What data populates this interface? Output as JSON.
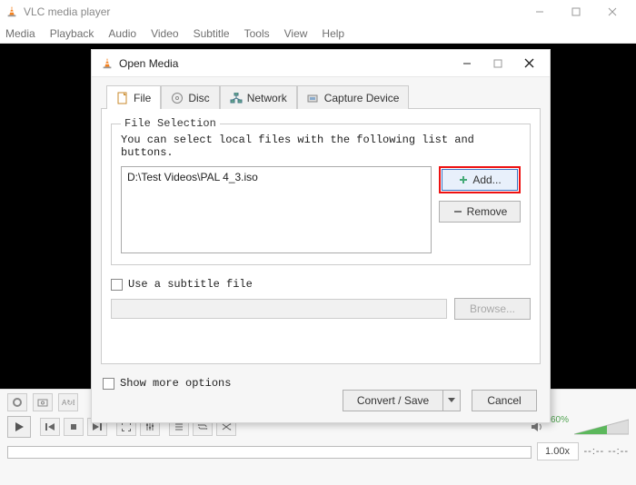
{
  "main_window": {
    "title": "VLC media player",
    "menu": [
      "Media",
      "Playback",
      "Audio",
      "Video",
      "Subtitle",
      "Tools",
      "View",
      "Help"
    ],
    "speed": "1.00x",
    "time_dashes": "--:--     --:--",
    "volume_percent": "60%"
  },
  "dialog": {
    "title": "Open Media",
    "tabs": {
      "file": "File",
      "disc": "Disc",
      "network": "Network",
      "capture": "Capture Device"
    },
    "file_selection": {
      "legend": "File Selection",
      "hint": "You can select local files with the following list and buttons.",
      "files": [
        "D:\\Test Videos\\PAL 4_3.iso"
      ],
      "add_label": "Add...",
      "remove_label": "Remove"
    },
    "subtitle": {
      "checkbox_label": "Use a subtitle file",
      "browse_label": "Browse..."
    },
    "more_options_label": "Show more options",
    "convert_label": "Convert / Save",
    "cancel_label": "Cancel"
  }
}
